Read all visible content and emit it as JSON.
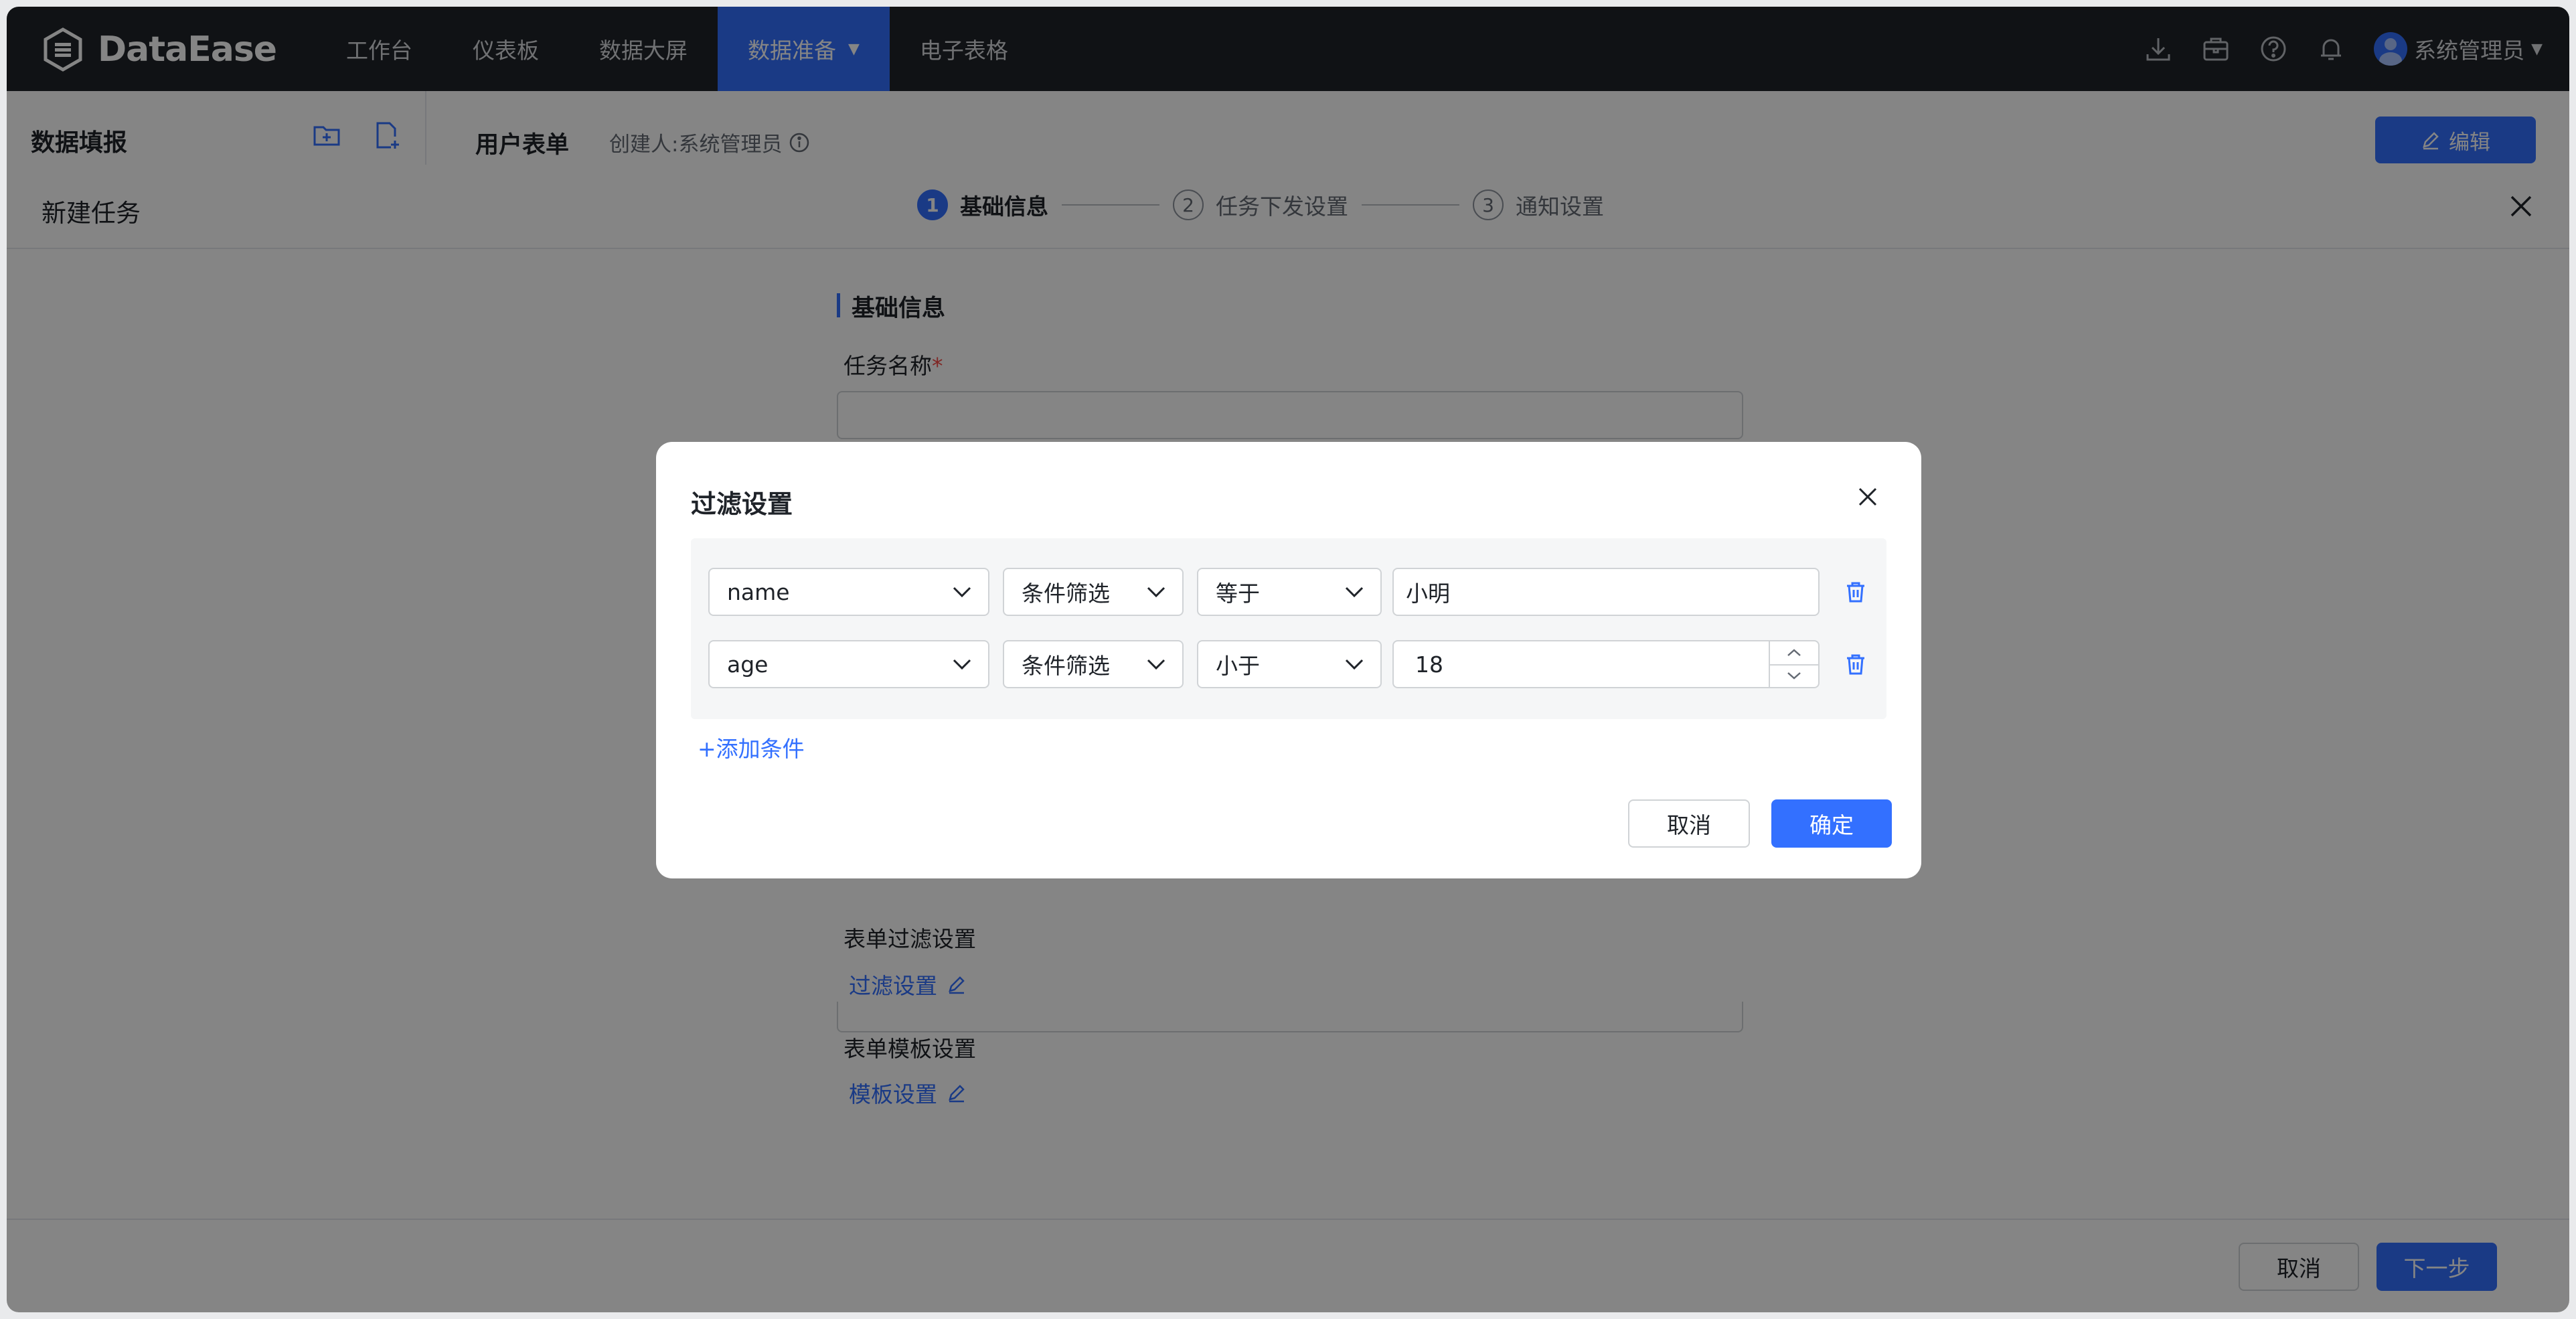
{
  "app": {
    "logo_text": "DataEase"
  },
  "nav": {
    "items": [
      {
        "label": "工作台"
      },
      {
        "label": "仪表板"
      },
      {
        "label": "数据大屏"
      },
      {
        "label": "数据准备",
        "active": true
      },
      {
        "label": "电子表格"
      }
    ],
    "caret": "▼"
  },
  "user": {
    "name": "系统管理员",
    "caret": "▼"
  },
  "subheader": {
    "section": "数据填报",
    "form_title": "用户表单",
    "creator": "创建人:系统管理员",
    "edit_label": "编辑"
  },
  "drawer": {
    "title": "新建任务",
    "steps": [
      {
        "num": "1",
        "label": "基础信息",
        "active": true
      },
      {
        "num": "2",
        "label": "任务下发设置"
      },
      {
        "num": "3",
        "label": "通知设置"
      }
    ],
    "section_title": "基础信息",
    "task_name_label": "任务名称",
    "required_mark": "*",
    "filter_section_label": "表单过滤设置",
    "filter_link": "过滤设置",
    "template_section_label": "表单模板设置",
    "template_link": "模板设置",
    "cancel_label": "取消",
    "next_label": "下一步"
  },
  "modal": {
    "title": "过滤设置",
    "conditions": [
      {
        "field": "name",
        "filter_type": "条件筛选",
        "operator": "等于",
        "value": "小明"
      },
      {
        "field": "age",
        "filter_type": "条件筛选",
        "operator": "小于",
        "value": "18"
      }
    ],
    "add_condition": "+添加条件",
    "cancel_label": "取消",
    "confirm_label": "确定"
  },
  "colors": {
    "accent": "#3370ff",
    "topbar": "#1f2329",
    "required": "#f54a45"
  }
}
